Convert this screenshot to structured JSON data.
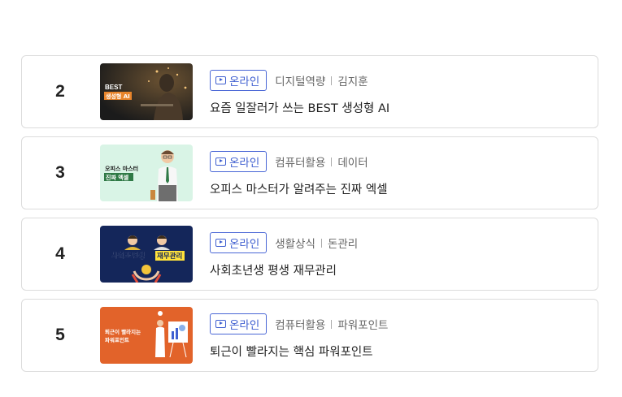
{
  "courses": [
    {
      "rank": "2",
      "badge": "온라인",
      "category": "디지털역량",
      "subcategory": "김지훈",
      "title": "요즘 일잘러가 쓰는 BEST 생성형 AI",
      "thumb_text": [
        "BEST",
        "생성형 AI"
      ]
    },
    {
      "rank": "3",
      "badge": "온라인",
      "category": "컴퓨터활용",
      "subcategory": "데이터",
      "title": "오피스 마스터가 알려주는 진짜 엑셀",
      "thumb_text": [
        "오피스 마스터",
        "진짜 엑셀"
      ]
    },
    {
      "rank": "4",
      "badge": "온라인",
      "category": "생활상식",
      "subcategory": "돈관리",
      "title": "사회초년생 평생 재무관리",
      "thumb_text": [
        "사회초년생",
        "재무관리"
      ]
    },
    {
      "rank": "5",
      "badge": "온라인",
      "category": "컴퓨터활용",
      "subcategory": "파워포인트",
      "title": "퇴근이 빨라지는 핵심 파워포인트",
      "thumb_text": [
        "퇴근이 빨라지는",
        "파워포인트"
      ]
    }
  ],
  "colors": {
    "badge_blue": "#3f5fd0",
    "thumb_ai_bg": "#2a2a2a",
    "thumb_excel_bg": "#d9f4e6",
    "thumb_finance_bg": "#14265a",
    "thumb_ppt_bg": "#e2632a"
  }
}
